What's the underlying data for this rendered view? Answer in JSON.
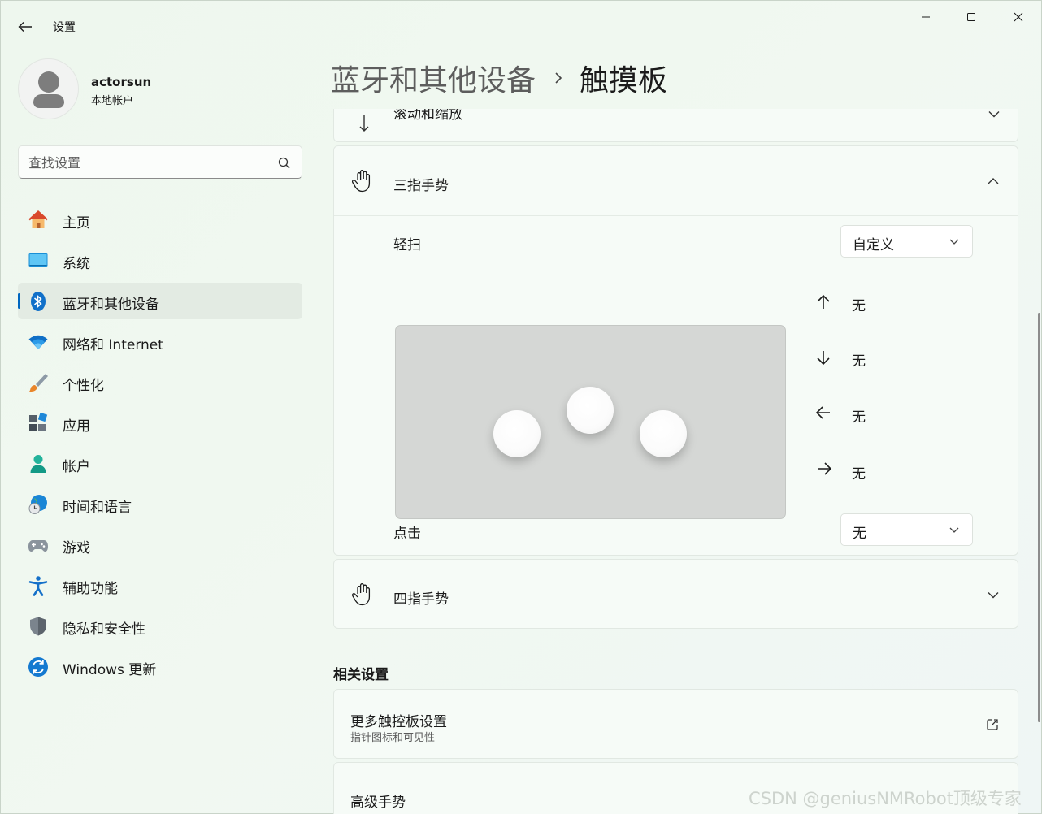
{
  "window": {
    "title": "设置"
  },
  "profile": {
    "name": "actorsun",
    "account_type": "本地帐户"
  },
  "search": {
    "placeholder": "查找设置"
  },
  "nav": {
    "items": [
      {
        "label": "主页",
        "icon": "home-icon"
      },
      {
        "label": "系统",
        "icon": "system-icon"
      },
      {
        "label": "蓝牙和其他设备",
        "icon": "bluetooth-icon",
        "active": true
      },
      {
        "label": "网络和 Internet",
        "icon": "wifi-icon"
      },
      {
        "label": "个性化",
        "icon": "brush-icon"
      },
      {
        "label": "应用",
        "icon": "apps-icon"
      },
      {
        "label": "帐户",
        "icon": "account-icon"
      },
      {
        "label": "时间和语言",
        "icon": "globe-clock-icon"
      },
      {
        "label": "游戏",
        "icon": "gamepad-icon"
      },
      {
        "label": "辅助功能",
        "icon": "accessibility-icon"
      },
      {
        "label": "隐私和安全性",
        "icon": "shield-icon"
      },
      {
        "label": "Windows 更新",
        "icon": "update-icon"
      }
    ]
  },
  "header": {
    "parent": "蓝牙和其他设备",
    "current": "触摸板"
  },
  "sections": {
    "scroll_zoom": {
      "label": "滚动和缩放"
    },
    "three_finger": {
      "label": "三指手势",
      "swipe": {
        "label": "轻扫",
        "value": "自定义",
        "up": "无",
        "down": "无",
        "left": "无",
        "right": "无"
      },
      "tap": {
        "label": "点击",
        "value": "无"
      }
    },
    "four_finger": {
      "label": "四指手势"
    }
  },
  "related": {
    "title": "相关设置",
    "more_touchpad": {
      "title": "更多触控板设置",
      "subtitle": "指针图标和可见性"
    },
    "advanced": {
      "title": "高级手势"
    }
  },
  "watermark": "CSDN @geniusNMRobot顶级专家",
  "colors": {
    "accent": "#0067c0",
    "active_nav_bg": "#e3ebe3",
    "touchpad": "#d5d7d5"
  }
}
